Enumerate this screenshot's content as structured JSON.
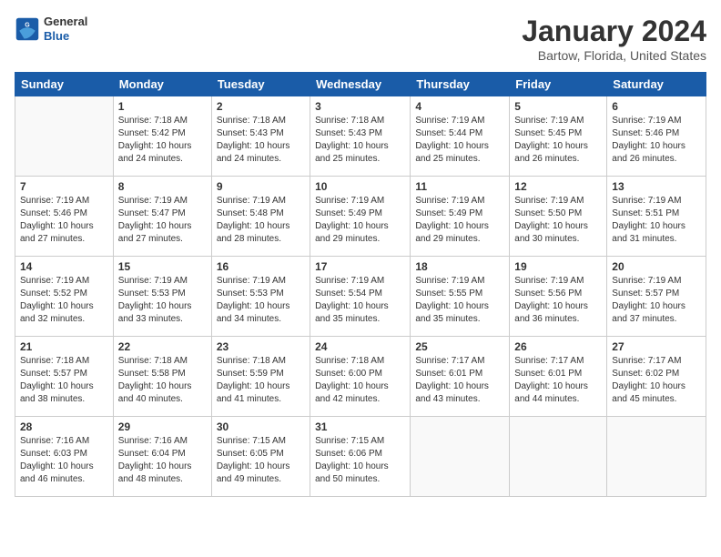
{
  "header": {
    "logo_general": "General",
    "logo_blue": "Blue",
    "month_title": "January 2024",
    "location": "Bartow, Florida, United States"
  },
  "days_of_week": [
    "Sunday",
    "Monday",
    "Tuesday",
    "Wednesday",
    "Thursday",
    "Friday",
    "Saturday"
  ],
  "weeks": [
    [
      {
        "day": "",
        "info": ""
      },
      {
        "day": "1",
        "info": "Sunrise: 7:18 AM\nSunset: 5:42 PM\nDaylight: 10 hours\nand 24 minutes."
      },
      {
        "day": "2",
        "info": "Sunrise: 7:18 AM\nSunset: 5:43 PM\nDaylight: 10 hours\nand 24 minutes."
      },
      {
        "day": "3",
        "info": "Sunrise: 7:18 AM\nSunset: 5:43 PM\nDaylight: 10 hours\nand 25 minutes."
      },
      {
        "day": "4",
        "info": "Sunrise: 7:19 AM\nSunset: 5:44 PM\nDaylight: 10 hours\nand 25 minutes."
      },
      {
        "day": "5",
        "info": "Sunrise: 7:19 AM\nSunset: 5:45 PM\nDaylight: 10 hours\nand 26 minutes."
      },
      {
        "day": "6",
        "info": "Sunrise: 7:19 AM\nSunset: 5:46 PM\nDaylight: 10 hours\nand 26 minutes."
      }
    ],
    [
      {
        "day": "7",
        "info": "Sunrise: 7:19 AM\nSunset: 5:46 PM\nDaylight: 10 hours\nand 27 minutes."
      },
      {
        "day": "8",
        "info": "Sunrise: 7:19 AM\nSunset: 5:47 PM\nDaylight: 10 hours\nand 27 minutes."
      },
      {
        "day": "9",
        "info": "Sunrise: 7:19 AM\nSunset: 5:48 PM\nDaylight: 10 hours\nand 28 minutes."
      },
      {
        "day": "10",
        "info": "Sunrise: 7:19 AM\nSunset: 5:49 PM\nDaylight: 10 hours\nand 29 minutes."
      },
      {
        "day": "11",
        "info": "Sunrise: 7:19 AM\nSunset: 5:49 PM\nDaylight: 10 hours\nand 29 minutes."
      },
      {
        "day": "12",
        "info": "Sunrise: 7:19 AM\nSunset: 5:50 PM\nDaylight: 10 hours\nand 30 minutes."
      },
      {
        "day": "13",
        "info": "Sunrise: 7:19 AM\nSunset: 5:51 PM\nDaylight: 10 hours\nand 31 minutes."
      }
    ],
    [
      {
        "day": "14",
        "info": "Sunrise: 7:19 AM\nSunset: 5:52 PM\nDaylight: 10 hours\nand 32 minutes."
      },
      {
        "day": "15",
        "info": "Sunrise: 7:19 AM\nSunset: 5:53 PM\nDaylight: 10 hours\nand 33 minutes."
      },
      {
        "day": "16",
        "info": "Sunrise: 7:19 AM\nSunset: 5:53 PM\nDaylight: 10 hours\nand 34 minutes."
      },
      {
        "day": "17",
        "info": "Sunrise: 7:19 AM\nSunset: 5:54 PM\nDaylight: 10 hours\nand 35 minutes."
      },
      {
        "day": "18",
        "info": "Sunrise: 7:19 AM\nSunset: 5:55 PM\nDaylight: 10 hours\nand 35 minutes."
      },
      {
        "day": "19",
        "info": "Sunrise: 7:19 AM\nSunset: 5:56 PM\nDaylight: 10 hours\nand 36 minutes."
      },
      {
        "day": "20",
        "info": "Sunrise: 7:19 AM\nSunset: 5:57 PM\nDaylight: 10 hours\nand 37 minutes."
      }
    ],
    [
      {
        "day": "21",
        "info": "Sunrise: 7:18 AM\nSunset: 5:57 PM\nDaylight: 10 hours\nand 38 minutes."
      },
      {
        "day": "22",
        "info": "Sunrise: 7:18 AM\nSunset: 5:58 PM\nDaylight: 10 hours\nand 40 minutes."
      },
      {
        "day": "23",
        "info": "Sunrise: 7:18 AM\nSunset: 5:59 PM\nDaylight: 10 hours\nand 41 minutes."
      },
      {
        "day": "24",
        "info": "Sunrise: 7:18 AM\nSunset: 6:00 PM\nDaylight: 10 hours\nand 42 minutes."
      },
      {
        "day": "25",
        "info": "Sunrise: 7:17 AM\nSunset: 6:01 PM\nDaylight: 10 hours\nand 43 minutes."
      },
      {
        "day": "26",
        "info": "Sunrise: 7:17 AM\nSunset: 6:01 PM\nDaylight: 10 hours\nand 44 minutes."
      },
      {
        "day": "27",
        "info": "Sunrise: 7:17 AM\nSunset: 6:02 PM\nDaylight: 10 hours\nand 45 minutes."
      }
    ],
    [
      {
        "day": "28",
        "info": "Sunrise: 7:16 AM\nSunset: 6:03 PM\nDaylight: 10 hours\nand 46 minutes."
      },
      {
        "day": "29",
        "info": "Sunrise: 7:16 AM\nSunset: 6:04 PM\nDaylight: 10 hours\nand 48 minutes."
      },
      {
        "day": "30",
        "info": "Sunrise: 7:15 AM\nSunset: 6:05 PM\nDaylight: 10 hours\nand 49 minutes."
      },
      {
        "day": "31",
        "info": "Sunrise: 7:15 AM\nSunset: 6:06 PM\nDaylight: 10 hours\nand 50 minutes."
      },
      {
        "day": "",
        "info": ""
      },
      {
        "day": "",
        "info": ""
      },
      {
        "day": "",
        "info": ""
      }
    ]
  ]
}
